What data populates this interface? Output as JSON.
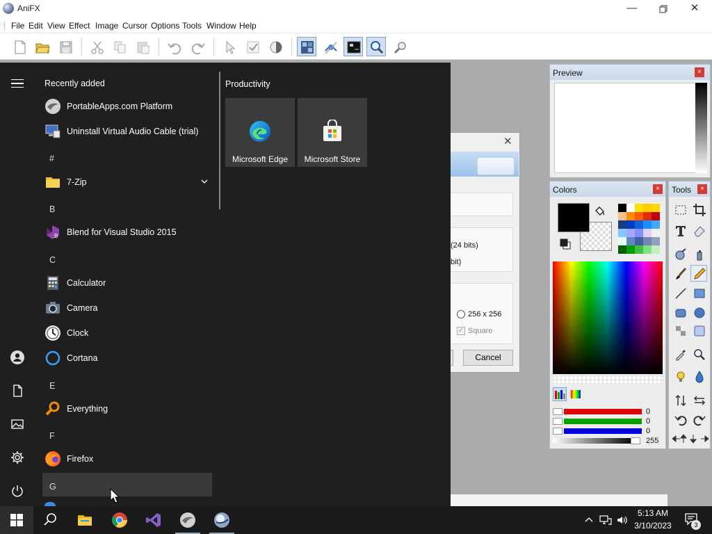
{
  "app": {
    "title": "AniFX",
    "menu": [
      "File",
      "Edit",
      "View",
      "Effect",
      "Image",
      "Cursor",
      "Options",
      "Tools",
      "Window",
      "Help"
    ]
  },
  "dialog": {
    "option_24bits": "(24 bits)",
    "option_bit": "bit)",
    "size_option": "256 x 256",
    "square_label": "Square",
    "cancel_label": "Cancel"
  },
  "panels": {
    "preview_title": "Preview",
    "colors_title": "Colors",
    "tools_title": "Tools",
    "close_glyph": "×",
    "rgba": {
      "red": "0",
      "green": "0",
      "blue": "0",
      "alpha": "255"
    },
    "slider_colors": {
      "red": "#e00000",
      "green": "#00a000",
      "blue": "#0000e0"
    }
  },
  "start_menu": {
    "recently_added_header": "Recently added",
    "recent": [
      "PortableApps.com Platform",
      "Uninstall Virtual Audio Cable (trial)"
    ],
    "letters": {
      "hash": "#",
      "b": "B",
      "c": "C",
      "e": "E",
      "f": "F",
      "g": "G"
    },
    "apps": {
      "seven_zip": "7-Zip",
      "blend": "Blend for Visual Studio 2015",
      "calculator": "Calculator",
      "camera": "Camera",
      "clock": "Clock",
      "cortana": "Cortana",
      "everything": "Everything",
      "firefox": "Firefox"
    },
    "tiles_group": "Productivity",
    "tiles": [
      "Microsoft Edge",
      "Microsoft Store"
    ]
  },
  "taskbar": {
    "time": "5:13 AM",
    "date": "3/10/2023",
    "notifications": "3"
  }
}
